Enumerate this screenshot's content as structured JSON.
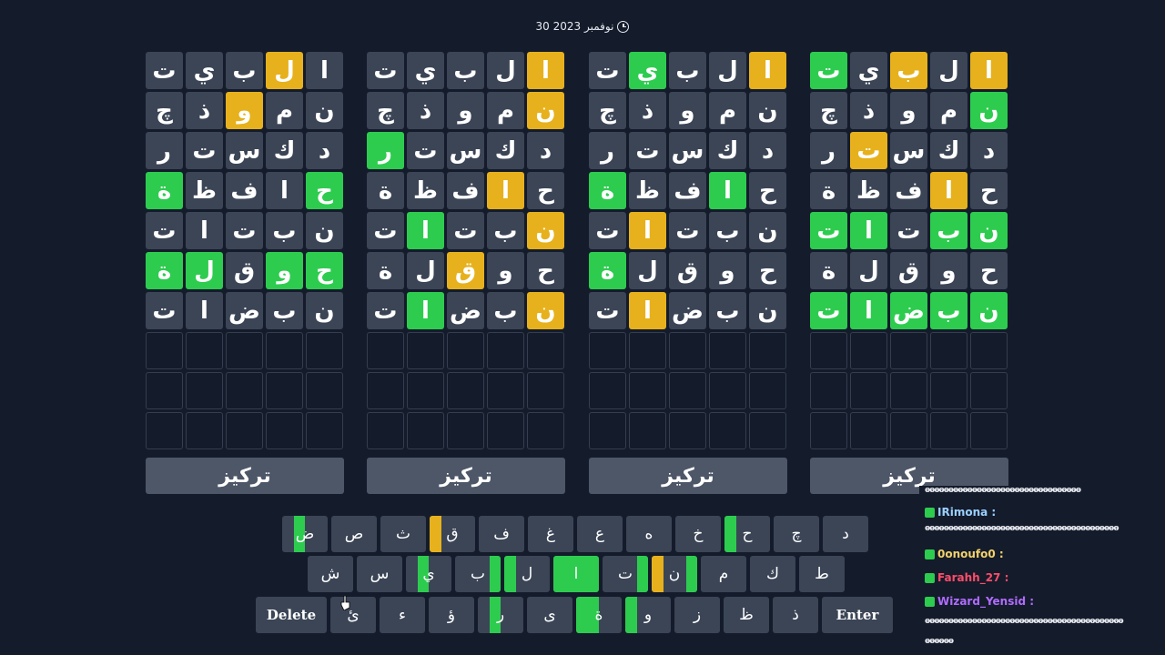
{
  "date": {
    "text": "30 نوفمبر 2023",
    "icon": "clock-icon"
  },
  "colors": {
    "green": "#2dcc4f",
    "yellow": "#e6b11c",
    "gray": "#3b4556",
    "background": "#141b2b"
  },
  "boards": [
    {
      "button": "تركيز",
      "rows": [
        [
          [
            "ت",
            "g"
          ],
          [
            "ي",
            "g"
          ],
          [
            "ب",
            "g"
          ],
          [
            "ل",
            "y"
          ],
          [
            "ا",
            "g"
          ]
        ],
        [
          [
            "چ",
            "g"
          ],
          [
            "ذ",
            "g"
          ],
          [
            "و",
            "y"
          ],
          [
            "م",
            "g"
          ],
          [
            "ن",
            "g"
          ]
        ],
        [
          [
            "ر",
            "g"
          ],
          [
            "ت",
            "g"
          ],
          [
            "س",
            "g"
          ],
          [
            "ك",
            "g"
          ],
          [
            "د",
            "g"
          ]
        ],
        [
          [
            "ة",
            "G"
          ],
          [
            "ظ",
            "g"
          ],
          [
            "ف",
            "g"
          ],
          [
            "ا",
            "g"
          ],
          [
            "ح",
            "G"
          ]
        ],
        [
          [
            "ت",
            "g"
          ],
          [
            "ا",
            "g"
          ],
          [
            "ت",
            "g"
          ],
          [
            "ب",
            "g"
          ],
          [
            "ن",
            "g"
          ]
        ],
        [
          [
            "ة",
            "G"
          ],
          [
            "ل",
            "G"
          ],
          [
            "ق",
            "g"
          ],
          [
            "و",
            "G"
          ],
          [
            "ح",
            "G"
          ]
        ],
        [
          [
            "ت",
            "g"
          ],
          [
            "ا",
            "g"
          ],
          [
            "ض",
            "g"
          ],
          [
            "ب",
            "g"
          ],
          [
            "ن",
            "g"
          ]
        ]
      ]
    },
    {
      "button": "تركيز",
      "rows": [
        [
          [
            "ت",
            "g"
          ],
          [
            "ي",
            "g"
          ],
          [
            "ب",
            "g"
          ],
          [
            "ل",
            "g"
          ],
          [
            "ا",
            "y"
          ]
        ],
        [
          [
            "چ",
            "g"
          ],
          [
            "ذ",
            "g"
          ],
          [
            "و",
            "g"
          ],
          [
            "م",
            "g"
          ],
          [
            "ن",
            "y"
          ]
        ],
        [
          [
            "ر",
            "G"
          ],
          [
            "ت",
            "g"
          ],
          [
            "س",
            "g"
          ],
          [
            "ك",
            "g"
          ],
          [
            "د",
            "g"
          ]
        ],
        [
          [
            "ة",
            "g"
          ],
          [
            "ظ",
            "g"
          ],
          [
            "ف",
            "g"
          ],
          [
            "ا",
            "y"
          ],
          [
            "ح",
            "g"
          ]
        ],
        [
          [
            "ت",
            "g"
          ],
          [
            "ا",
            "G"
          ],
          [
            "ت",
            "g"
          ],
          [
            "ب",
            "g"
          ],
          [
            "ن",
            "y"
          ]
        ],
        [
          [
            "ة",
            "g"
          ],
          [
            "ل",
            "g"
          ],
          [
            "ق",
            "y"
          ],
          [
            "و",
            "g"
          ],
          [
            "ح",
            "g"
          ]
        ],
        [
          [
            "ت",
            "g"
          ],
          [
            "ا",
            "G"
          ],
          [
            "ض",
            "g"
          ],
          [
            "ب",
            "g"
          ],
          [
            "ن",
            "y"
          ]
        ]
      ]
    },
    {
      "button": "تركيز",
      "rows": [
        [
          [
            "ت",
            "g"
          ],
          [
            "ي",
            "G"
          ],
          [
            "ب",
            "g"
          ],
          [
            "ل",
            "g"
          ],
          [
            "ا",
            "y"
          ]
        ],
        [
          [
            "چ",
            "g"
          ],
          [
            "ذ",
            "g"
          ],
          [
            "و",
            "g"
          ],
          [
            "م",
            "g"
          ],
          [
            "ن",
            "g"
          ]
        ],
        [
          [
            "ر",
            "g"
          ],
          [
            "ت",
            "g"
          ],
          [
            "س",
            "g"
          ],
          [
            "ك",
            "g"
          ],
          [
            "د",
            "g"
          ]
        ],
        [
          [
            "ة",
            "G"
          ],
          [
            "ظ",
            "g"
          ],
          [
            "ف",
            "g"
          ],
          [
            "ا",
            "G"
          ],
          [
            "ح",
            "g"
          ]
        ],
        [
          [
            "ت",
            "g"
          ],
          [
            "ا",
            "y"
          ],
          [
            "ت",
            "g"
          ],
          [
            "ب",
            "g"
          ],
          [
            "ن",
            "g"
          ]
        ],
        [
          [
            "ة",
            "G"
          ],
          [
            "ل",
            "g"
          ],
          [
            "ق",
            "g"
          ],
          [
            "و",
            "g"
          ],
          [
            "ح",
            "g"
          ]
        ],
        [
          [
            "ت",
            "g"
          ],
          [
            "ا",
            "y"
          ],
          [
            "ض",
            "g"
          ],
          [
            "ب",
            "g"
          ],
          [
            "ن",
            "g"
          ]
        ]
      ]
    },
    {
      "button": "تركيز",
      "rows": [
        [
          [
            "ت",
            "G"
          ],
          [
            "ي",
            "g"
          ],
          [
            "ب",
            "y"
          ],
          [
            "ل",
            "g"
          ],
          [
            "ا",
            "y"
          ]
        ],
        [
          [
            "چ",
            "g"
          ],
          [
            "ذ",
            "g"
          ],
          [
            "و",
            "g"
          ],
          [
            "م",
            "g"
          ],
          [
            "ن",
            "G"
          ]
        ],
        [
          [
            "ر",
            "g"
          ],
          [
            "ت",
            "y"
          ],
          [
            "س",
            "g"
          ],
          [
            "ك",
            "g"
          ],
          [
            "د",
            "g"
          ]
        ],
        [
          [
            "ة",
            "g"
          ],
          [
            "ظ",
            "g"
          ],
          [
            "ف",
            "g"
          ],
          [
            "ا",
            "y"
          ],
          [
            "ح",
            "g"
          ]
        ],
        [
          [
            "ت",
            "G"
          ],
          [
            "ا",
            "G"
          ],
          [
            "ت",
            "g"
          ],
          [
            "ب",
            "G"
          ],
          [
            "ن",
            "G"
          ]
        ],
        [
          [
            "ة",
            "g"
          ],
          [
            "ل",
            "g"
          ],
          [
            "ق",
            "g"
          ],
          [
            "و",
            "g"
          ],
          [
            "ح",
            "g"
          ]
        ],
        [
          [
            "ت",
            "G"
          ],
          [
            "ا",
            "G"
          ],
          [
            "ض",
            "G"
          ],
          [
            "ب",
            "G"
          ],
          [
            "ن",
            "G"
          ]
        ]
      ]
    }
  ],
  "keyboard": {
    "row1": [
      {
        "k": "ض",
        "m": [
          null,
          "G",
          null,
          null
        ]
      },
      {
        "k": "ص",
        "m": [
          null,
          null,
          null,
          null
        ]
      },
      {
        "k": "ث",
        "m": [
          null,
          null,
          null,
          null
        ]
      },
      {
        "k": "ق",
        "m": [
          "y",
          null,
          null,
          null
        ]
      },
      {
        "k": "ف",
        "m": [
          null,
          null,
          null,
          null
        ]
      },
      {
        "k": "غ",
        "m": [
          null,
          null,
          null,
          null
        ]
      },
      {
        "k": "ع",
        "m": [
          null,
          null,
          null,
          null
        ]
      },
      {
        "k": "ه",
        "m": [
          null,
          null,
          null,
          null
        ]
      },
      {
        "k": "خ",
        "m": [
          null,
          null,
          null,
          null
        ]
      },
      {
        "k": "ح",
        "m": [
          "G",
          null,
          null,
          null
        ]
      },
      {
        "k": "چ",
        "m": [
          null,
          null,
          null,
          null
        ]
      },
      {
        "k": "د",
        "m": [
          null,
          null,
          null,
          null
        ]
      }
    ],
    "row2": [
      {
        "k": "ش",
        "m": [
          null,
          null,
          null,
          null
        ]
      },
      {
        "k": "س",
        "m": [
          null,
          null,
          null,
          null
        ]
      },
      {
        "k": "ي",
        "m": [
          null,
          "G",
          null,
          null
        ]
      },
      {
        "k": "ب",
        "m": [
          null,
          null,
          null,
          "G"
        ]
      },
      {
        "k": "ل",
        "m": [
          "G",
          null,
          null,
          null
        ]
      },
      {
        "k": "ا",
        "m": [
          "G",
          "G",
          "G",
          "G"
        ]
      },
      {
        "k": "ت",
        "m": [
          null,
          null,
          null,
          "G"
        ]
      },
      {
        "k": "ن",
        "m": [
          "y",
          null,
          null,
          "G"
        ]
      },
      {
        "k": "م",
        "m": [
          null,
          null,
          null,
          null
        ]
      },
      {
        "k": "ك",
        "m": [
          null,
          null,
          null,
          null
        ]
      },
      {
        "k": "ط",
        "m": [
          null,
          null,
          null,
          null
        ]
      }
    ],
    "row3": [
      {
        "k": "Delete",
        "wide": true,
        "m": [
          null,
          null,
          null,
          null
        ]
      },
      {
        "k": "ئ",
        "m": [
          null,
          null,
          null,
          null
        ]
      },
      {
        "k": "ء",
        "m": [
          null,
          null,
          null,
          null
        ]
      },
      {
        "k": "ؤ",
        "m": [
          null,
          null,
          null,
          null
        ]
      },
      {
        "k": "ر",
        "m": [
          null,
          "G",
          null,
          null
        ]
      },
      {
        "k": "ى",
        "m": [
          null,
          null,
          null,
          null
        ]
      },
      {
        "k": "ة",
        "m": [
          "G",
          "G",
          null,
          null
        ]
      },
      {
        "k": "و",
        "m": [
          "G",
          null,
          null,
          null
        ]
      },
      {
        "k": "ز",
        "m": [
          null,
          null,
          null,
          null
        ]
      },
      {
        "k": "ظ",
        "m": [
          null,
          null,
          null,
          null
        ]
      },
      {
        "k": "ذ",
        "m": [
          null,
          null,
          null,
          null
        ]
      },
      {
        "k": "Enter",
        "wide": true,
        "m": [
          null,
          null,
          null,
          null
        ]
      }
    ]
  },
  "chat": [
    {
      "user": "",
      "msg": "ⱺⱺⱺⱺⱺⱺⱺⱺⱺⱺⱺⱺⱺⱺⱺⱺⱺⱺⱺⱺⱺⱺⱺⱺⱺⱺⱺⱺⱺⱺⱺⱺⱺ",
      "color": "#e6e9ef"
    },
    {
      "user": "IRimona :",
      "msg": "",
      "color": "#9bd0ff"
    },
    {
      "user": "",
      "msg": "ⱺⱺⱺⱺⱺⱺⱺⱺⱺⱺⱺⱺⱺⱺⱺⱺⱺⱺⱺⱺⱺⱺⱺⱺⱺⱺⱺⱺⱺⱺⱺⱺⱺⱺⱺⱺⱺⱺⱺⱺⱺ",
      "color": "#e6e9ef"
    },
    {
      "user": "0onoufo0 :",
      "msg": "",
      "color": "#f3d26a"
    },
    {
      "user": "Farahh_27 :",
      "msg": "",
      "color": "#ff4d6a"
    },
    {
      "user": "Wizard_Yensid :",
      "msg": "",
      "color": "#b06cff"
    },
    {
      "user": "",
      "msg": "ⱺⱺⱺⱺⱺⱺⱺⱺⱺⱺⱺⱺⱺⱺⱺⱺⱺⱺⱺⱺⱺⱺⱺⱺⱺⱺⱺⱺⱺⱺⱺⱺⱺⱺⱺⱺⱺⱺⱺⱺⱺⱺ",
      "color": "#e6e9ef"
    },
    {
      "user": "",
      "msg": "ⱺⱺⱺⱺⱺⱺ",
      "color": "#e6e9ef"
    }
  ]
}
